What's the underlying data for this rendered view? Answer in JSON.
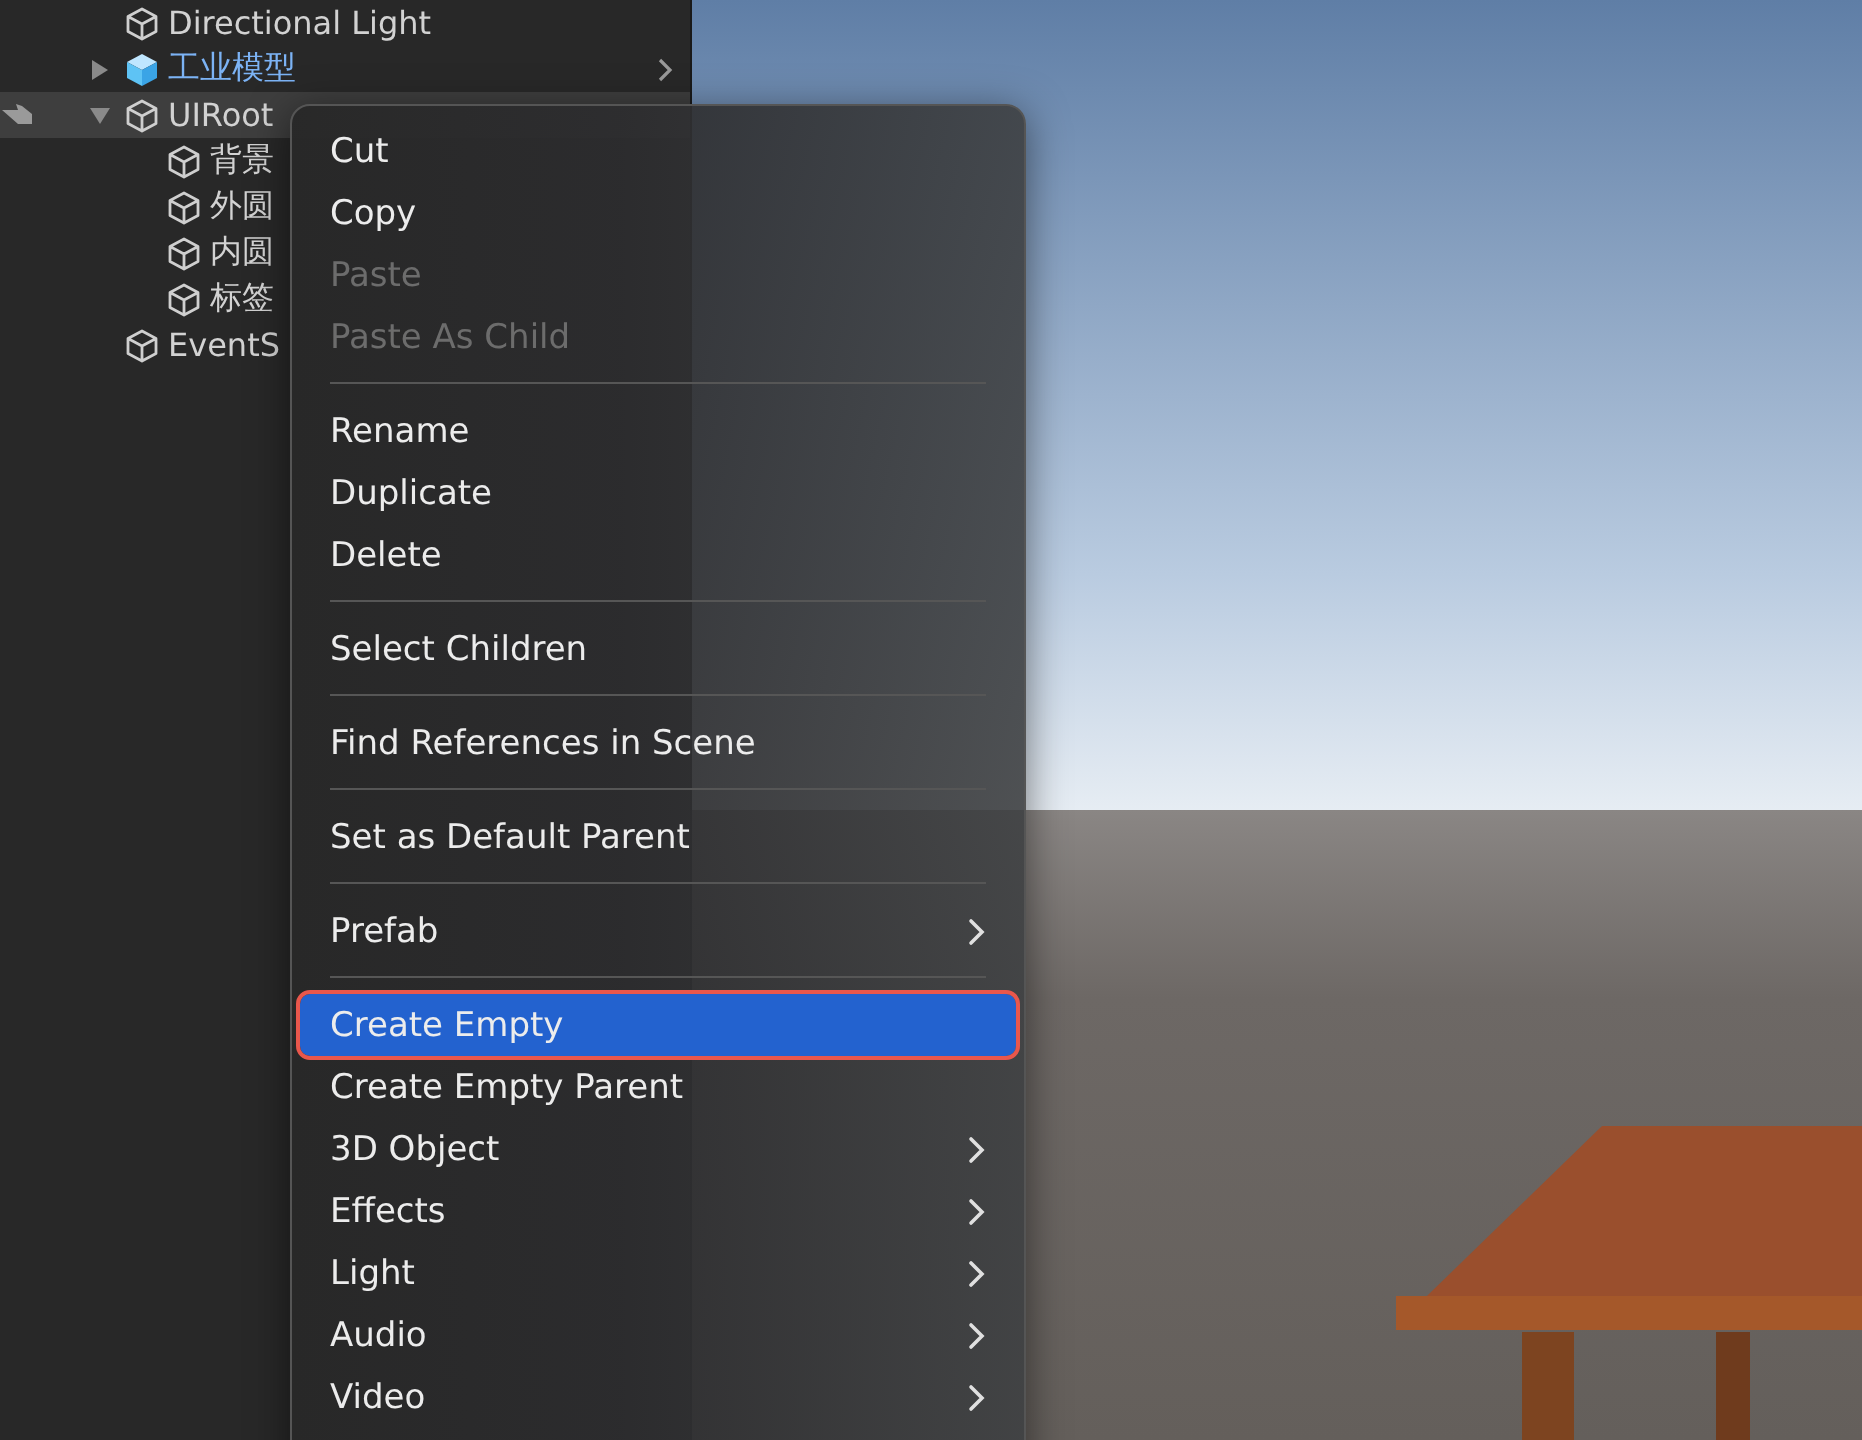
{
  "hierarchy": {
    "items": [
      {
        "label": "Directional Light",
        "kind": "object",
        "selected": false
      },
      {
        "label": "工业模型",
        "kind": "prefab",
        "selected": false,
        "expanded": false
      },
      {
        "label": "UIRoot",
        "kind": "object",
        "selected": true,
        "expanded": true,
        "children": [
          {
            "label": "背景",
            "kind": "object",
            "selected": false
          },
          {
            "label": "外圆",
            "kind": "object",
            "selected": false
          },
          {
            "label": "内圆",
            "kind": "object",
            "selected": false
          },
          {
            "label": "标签",
            "kind": "object",
            "selected": false
          }
        ]
      },
      {
        "label": "EventS",
        "kind": "object",
        "selected": false
      }
    ]
  },
  "context_menu": {
    "items": [
      {
        "kind": "item",
        "label": "Cut",
        "disabled": false,
        "submenu": false,
        "selected": false
      },
      {
        "kind": "item",
        "label": "Copy",
        "disabled": false,
        "submenu": false,
        "selected": false
      },
      {
        "kind": "item",
        "label": "Paste",
        "disabled": true,
        "submenu": false,
        "selected": false
      },
      {
        "kind": "item",
        "label": "Paste As Child",
        "disabled": true,
        "submenu": false,
        "selected": false
      },
      {
        "kind": "separator"
      },
      {
        "kind": "item",
        "label": "Rename",
        "disabled": false,
        "submenu": false,
        "selected": false
      },
      {
        "kind": "item",
        "label": "Duplicate",
        "disabled": false,
        "submenu": false,
        "selected": false
      },
      {
        "kind": "item",
        "label": "Delete",
        "disabled": false,
        "submenu": false,
        "selected": false
      },
      {
        "kind": "separator"
      },
      {
        "kind": "item",
        "label": "Select Children",
        "disabled": false,
        "submenu": false,
        "selected": false
      },
      {
        "kind": "separator"
      },
      {
        "kind": "item",
        "label": "Find References in Scene",
        "disabled": false,
        "submenu": false,
        "selected": false
      },
      {
        "kind": "separator"
      },
      {
        "kind": "item",
        "label": "Set as Default Parent",
        "disabled": false,
        "submenu": false,
        "selected": false
      },
      {
        "kind": "separator"
      },
      {
        "kind": "item",
        "label": "Prefab",
        "disabled": false,
        "submenu": true,
        "selected": false
      },
      {
        "kind": "separator"
      },
      {
        "kind": "item",
        "label": "Create Empty",
        "disabled": false,
        "submenu": false,
        "selected": true
      },
      {
        "kind": "item",
        "label": "Create Empty Parent",
        "disabled": false,
        "submenu": false,
        "selected": false
      },
      {
        "kind": "item",
        "label": "3D Object",
        "disabled": false,
        "submenu": true,
        "selected": false
      },
      {
        "kind": "item",
        "label": "Effects",
        "disabled": false,
        "submenu": true,
        "selected": false
      },
      {
        "kind": "item",
        "label": "Light",
        "disabled": false,
        "submenu": true,
        "selected": false
      },
      {
        "kind": "item",
        "label": "Audio",
        "disabled": false,
        "submenu": true,
        "selected": false
      },
      {
        "kind": "item",
        "label": "Video",
        "disabled": false,
        "submenu": true,
        "selected": false
      }
    ]
  }
}
